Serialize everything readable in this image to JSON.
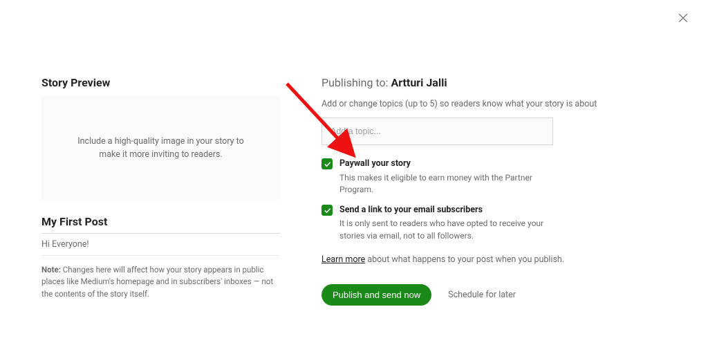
{
  "left": {
    "heading": "Story Preview",
    "preview_help": "Include a high-quality image in your story to make it more inviting to readers.",
    "title": "My First Post",
    "subtitle": "Hi Everyone!",
    "note_prefix": "Note:",
    "note_body": " Changes here will affect how your story appears in public places like Medium's homepage and in subscribers' inboxes — not the contents of the story itself."
  },
  "right": {
    "publishing_prefix": "Publishing to: ",
    "author": "Artturi Jalli",
    "topics_help": "Add or change topics (up to 5) so readers know what your story is about",
    "topic_placeholder": "Add a topic...",
    "opt_paywall_title": "Paywall your story",
    "opt_paywall_body": "This makes it eligible to earn money with the Partner Program.",
    "opt_email_title": "Send a link to your email subscribers",
    "opt_email_body": "It is only sent to readers who have opted to receive your stories via email, not to all followers.",
    "learn_link": "Learn more",
    "learn_rest": " about what happens to your post when you publish.",
    "publish_label": "Publish and send now",
    "schedule_label": "Schedule for later"
  }
}
